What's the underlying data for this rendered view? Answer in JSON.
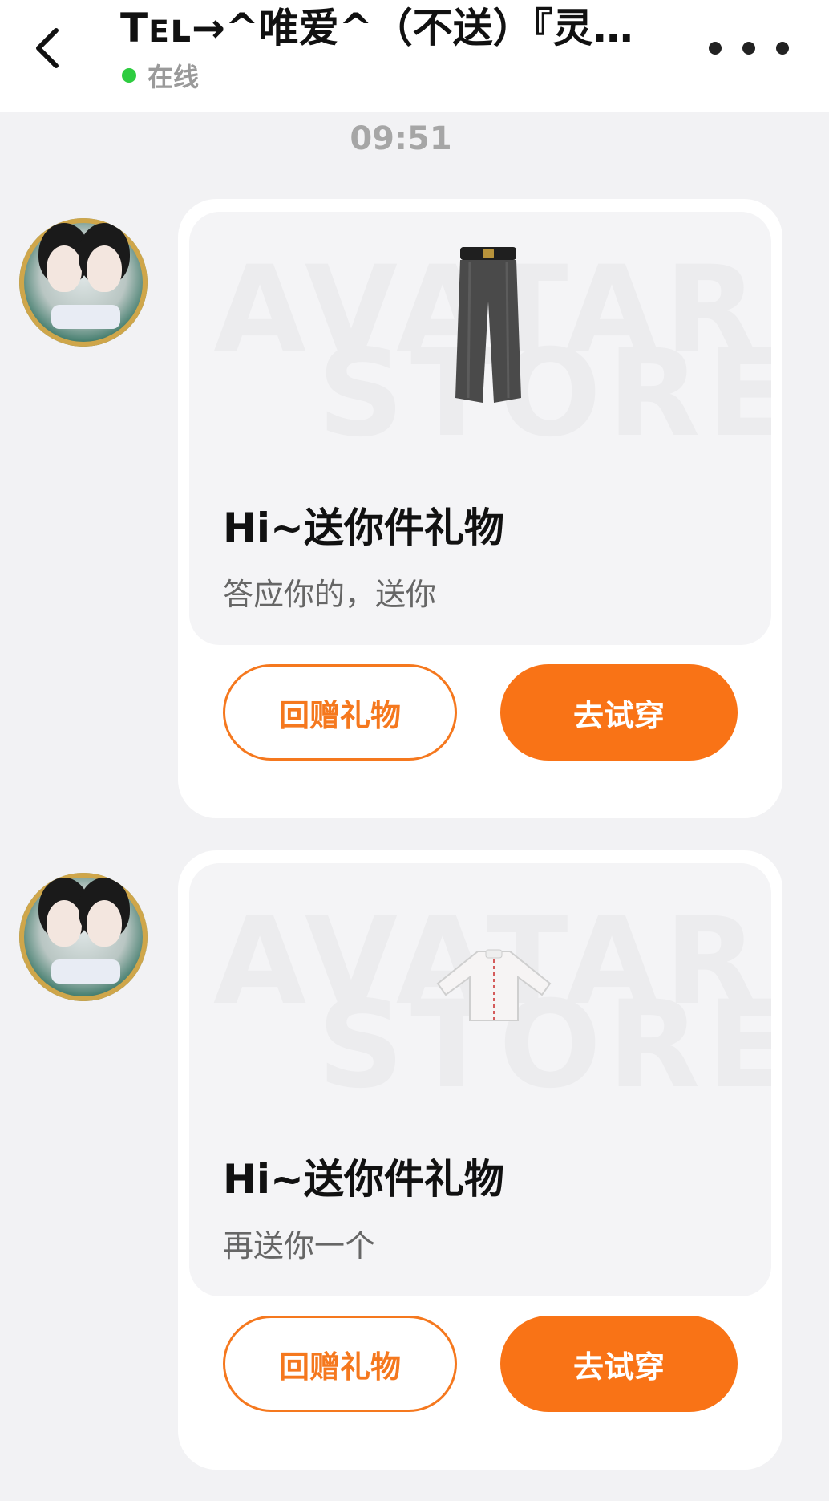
{
  "header": {
    "title": "Tᴇʟ→^唯爱^（不送）『灵…",
    "status_text": "在线",
    "status_color": "#2ecc40",
    "back_icon": "chevron-left-icon",
    "more_icon": "more-dots-icon"
  },
  "chat": {
    "timestamp": "09:51"
  },
  "messages": [
    {
      "watermark_line1": "AVATAR",
      "watermark_line2": "STORE",
      "gift_item": "black wide-leg trousers",
      "title": "Hi~送你件礼物",
      "text": "答应你的，送你",
      "return_label": "回赠礼物",
      "try_label": "去试穿"
    },
    {
      "watermark_line1": "AVATAR",
      "watermark_line2": "STORE",
      "gift_item": "white shirt",
      "title": "Hi~送你件礼物",
      "text": "再送你一个",
      "return_label": "回赠礼物",
      "try_label": "去试穿"
    }
  ],
  "colors": {
    "accent": "#f97316",
    "background": "#f2f2f4"
  }
}
